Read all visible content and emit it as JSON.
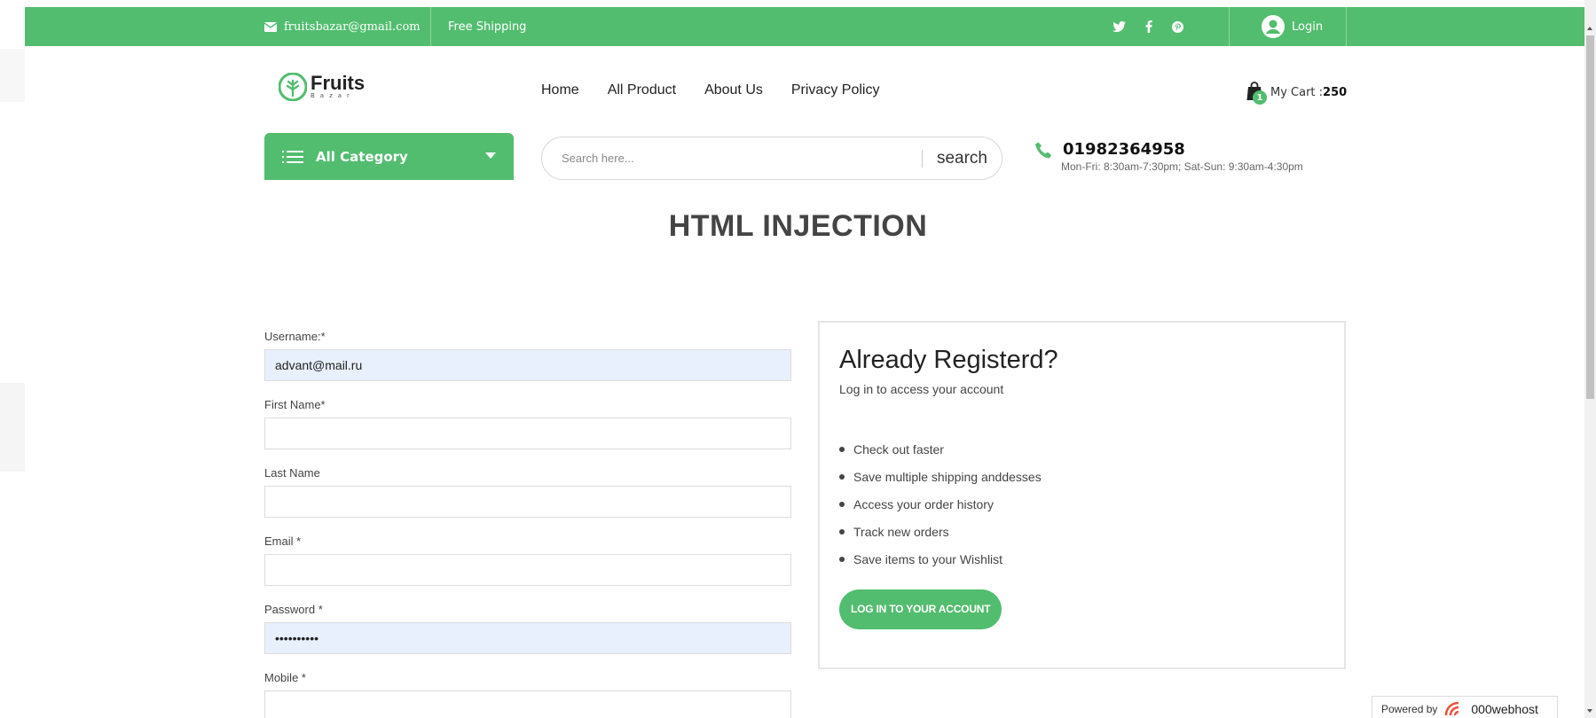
{
  "topbar": {
    "email": "fruitsbazar@gmail.com",
    "shipping": "Free Shipping",
    "socials": [
      "twitter-icon",
      "facebook-icon",
      "pinterest-icon"
    ],
    "login_label": "Login"
  },
  "brand": {
    "name": "Fruits",
    "tagline": "Bazar"
  },
  "nav": {
    "items": [
      "Home",
      "All Product",
      "About Us",
      "Privacy Policy"
    ]
  },
  "cart": {
    "badge": "1",
    "label": "My Cart :",
    "amount": "250"
  },
  "category": {
    "label": "All Category"
  },
  "search": {
    "placeholder": "Search here...",
    "button": "search"
  },
  "contact": {
    "phone": "01982364958",
    "hours": "Mon-Fri: 8:30am-7:30pm; Sat-Sun: 9:30am-4:30pm"
  },
  "page": {
    "title": "HTML INJECTION"
  },
  "form": {
    "username": {
      "label": "Username:*",
      "value": "advant@mail.ru"
    },
    "first_name": {
      "label": "First Name*",
      "value": ""
    },
    "last_name": {
      "label": "Last Name",
      "value": ""
    },
    "email": {
      "label": "Email *",
      "value": ""
    },
    "password": {
      "label": "Password *",
      "value": "••••••••••"
    },
    "mobile": {
      "label": "Mobile *",
      "value": ""
    }
  },
  "login_box": {
    "heading": "Already Registerd?",
    "lead": "Log in to access your account",
    "benefits": [
      "Check out faster",
      "Save multiple shipping anddesses",
      "Access your order history",
      "Track new orders",
      "Save items to your Wishlist"
    ],
    "button": "LOG IN TO YOUR ACCOUNT"
  },
  "footer": {
    "powered_label": "Powered by",
    "powered_brand": "000webhost"
  },
  "colors": {
    "accent": "#52bd6f",
    "filled_input": "#e8f0fe"
  }
}
